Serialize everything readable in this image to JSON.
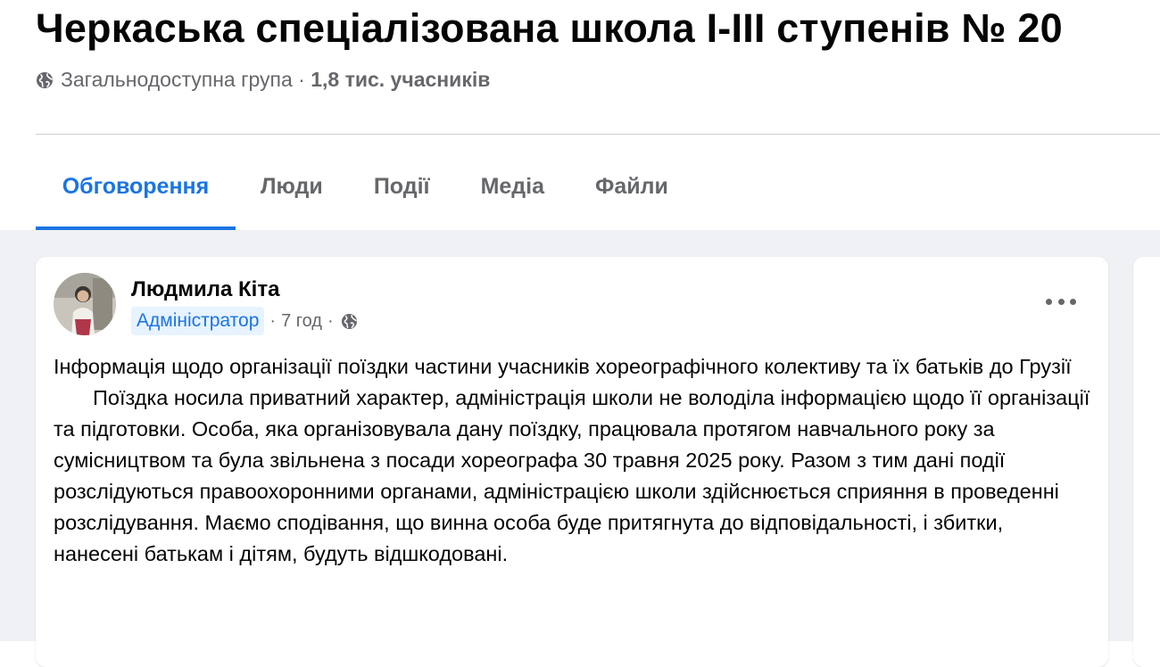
{
  "group": {
    "title": "Черкаська спеціалізована школа І-ІІІ ступенів № 20",
    "privacy": "Загальнодоступна група",
    "separator": " · ",
    "members": "1,8 тис. учасників"
  },
  "tabs": [
    {
      "label": "Обговорення",
      "active": true
    },
    {
      "label": "Люди",
      "active": false
    },
    {
      "label": "Події",
      "active": false
    },
    {
      "label": "Медіа",
      "active": false
    },
    {
      "label": "Файли",
      "active": false
    }
  ],
  "post": {
    "author": "Людмила Кіта",
    "role_badge": "Адміністратор",
    "time": "7 год",
    "separator": "·",
    "text_p1": "Інформація щодо організації поїздки частини учасників хореографічного колективу та їх батьків до Грузії",
    "text_p2": "Поїздка носила приватний характер, адміністрація школи  не володіла інформацією щодо її організації та підготовки. Особа, яка організовувала дану поїздку, працювала протягом навчального року за сумісництвом та була звільнена з посади хореографа 30 травня 2025 року. Разом з тим дані події розслідуються правоохоронними органами, адміністрацією школи здійснюється сприяння в проведенні розслідування. Маємо сподівання, що винна особа буде притягнута до відповідальності, і збитки, нанесені батькам і дітям, будуть відшкодовані."
  },
  "icons": {
    "privacy": "globe-icon",
    "audience": "globe-icon",
    "menu": "more-options-icon"
  },
  "colors": {
    "accent": "#1b74e4",
    "secondary_text": "#65676b",
    "feed_background": "#eff1f4",
    "badge_background": "#e7f3ff"
  }
}
